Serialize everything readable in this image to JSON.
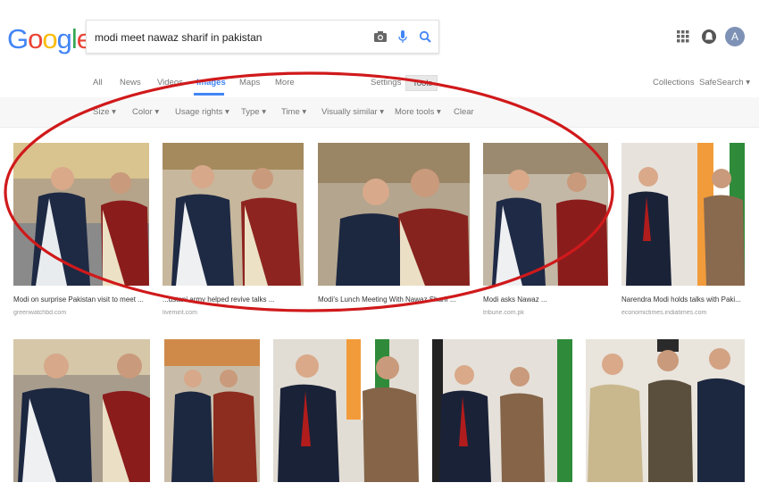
{
  "header": {
    "logo_letters": [
      {
        "char": "G",
        "color": "#4285f4"
      },
      {
        "char": "o",
        "color": "#ea4335"
      },
      {
        "char": "o",
        "color": "#fbbc05"
      },
      {
        "char": "g",
        "color": "#4285f4"
      },
      {
        "char": "l",
        "color": "#34a853"
      },
      {
        "char": "e",
        "color": "#ea4335"
      }
    ],
    "search_query": "modi meet nawaz sharif in pakistan",
    "avatar_letter": "A",
    "avatar_color": "#7e92b5"
  },
  "nav": {
    "tabs": [
      "All",
      "News",
      "Videos",
      "Images",
      "Maps",
      "More"
    ],
    "active_tab": "Images",
    "settings": "Settings",
    "tools": "Tools",
    "collections": "Collections",
    "safesearch": "SafeSearch"
  },
  "tools": {
    "items": [
      "Size",
      "Color",
      "Usage rights",
      "Type",
      "Time",
      "Visually similar",
      "More tools"
    ],
    "clear": "Clear"
  },
  "results_row1": [
    {
      "caption": "Modi on surprise Pakistan visit to meet ...",
      "source": "greenwatchbd.com"
    },
    {
      "caption": "...ustani army helped revive talks ...",
      "source": "livemint.com"
    },
    {
      "caption": "Modi's Lunch Meeting With Nawaz Sharif ...",
      "source": ""
    },
    {
      "caption": "Modi asks Nawaz ...",
      "source": "tribune.com.pk"
    },
    {
      "caption": "Narendra Modi holds talks with Paki...",
      "source": "economictimes.indiatimes.com"
    }
  ],
  "annotation_color": "#d0191b"
}
